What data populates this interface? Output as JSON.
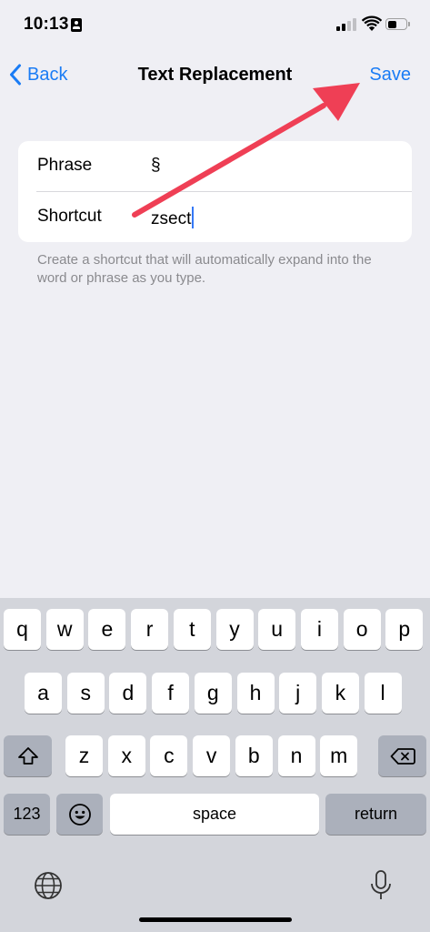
{
  "status_bar": {
    "time": "10:13",
    "id_badge_icon": "person-badge-icon",
    "signal_icon": "cellular-signal-icon",
    "wifi_icon": "wifi-icon",
    "battery_icon": "battery-icon",
    "battery_level": 0.5
  },
  "nav": {
    "back_label": "Back",
    "title": "Text Replacement",
    "save_label": "Save"
  },
  "form": {
    "phrase_label": "Phrase",
    "phrase_value": "§",
    "shortcut_label": "Shortcut",
    "shortcut_value": "zsect",
    "footer": "Create a shortcut that will automatically expand into the word or phrase as you type."
  },
  "keyboard": {
    "row1": [
      "q",
      "w",
      "e",
      "r",
      "t",
      "y",
      "u",
      "i",
      "o",
      "p"
    ],
    "row2": [
      "a",
      "s",
      "d",
      "f",
      "g",
      "h",
      "j",
      "k",
      "l"
    ],
    "row3": [
      "z",
      "x",
      "c",
      "v",
      "b",
      "n",
      "m"
    ],
    "shift_icon": "shift-icon",
    "delete_icon": "delete-backspace-icon",
    "numbers_label": "123",
    "emoji_icon": "emoji-icon",
    "space_label": "space",
    "return_label": "return",
    "globe_icon": "globe-icon",
    "mic_icon": "microphone-icon"
  },
  "annotation": {
    "arrow_color": "#ef3f55",
    "accent_color": "#1a7cf5"
  }
}
